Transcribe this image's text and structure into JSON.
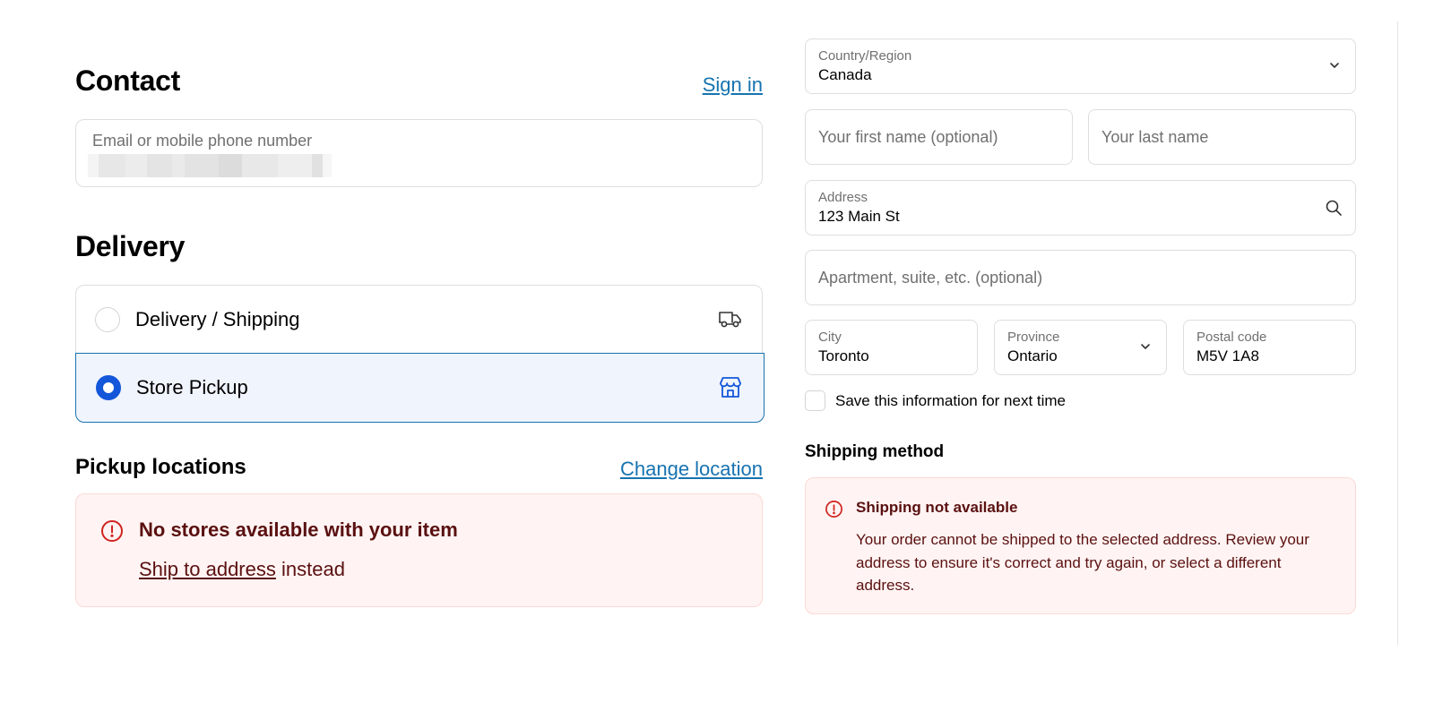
{
  "contact": {
    "title": "Contact",
    "sign_in": "Sign in",
    "email_label": "Email or mobile phone number"
  },
  "delivery": {
    "title": "Delivery",
    "options": [
      {
        "label": "Delivery / Shipping",
        "icon": "truck-icon",
        "selected": false
      },
      {
        "label": "Store Pickup",
        "icon": "store-icon",
        "selected": true
      }
    ]
  },
  "pickup": {
    "title": "Pickup locations",
    "change_location": "Change location",
    "alert_title": "No stores available with your item",
    "alert_link": "Ship to address",
    "alert_suffix": " instead"
  },
  "address_form": {
    "country_label": "Country/Region",
    "country_value": "Canada",
    "first_name_placeholder": "Your first name (optional)",
    "last_name_placeholder": "Your last name",
    "address_label": "Address",
    "address_value": "123 Main St",
    "apartment_placeholder": "Apartment, suite, etc. (optional)",
    "city_label": "City",
    "city_value": "Toronto",
    "province_label": "Province",
    "province_value": "Ontario",
    "postal_label": "Postal code",
    "postal_value": "M5V 1A8",
    "save_info": "Save this information for next time"
  },
  "shipping_method": {
    "title": "Shipping method",
    "alert_title": "Shipping not available",
    "alert_body": "Your order cannot be shipped to the selected address. Review your address to ensure it's correct and try again, or select a different address."
  },
  "colors": {
    "link": "#1773b0",
    "radio_selected": "#1356d9",
    "alert_bg": "#fff4f3",
    "alert_text": "#5a1010",
    "alert_icon": "#d0231f"
  }
}
